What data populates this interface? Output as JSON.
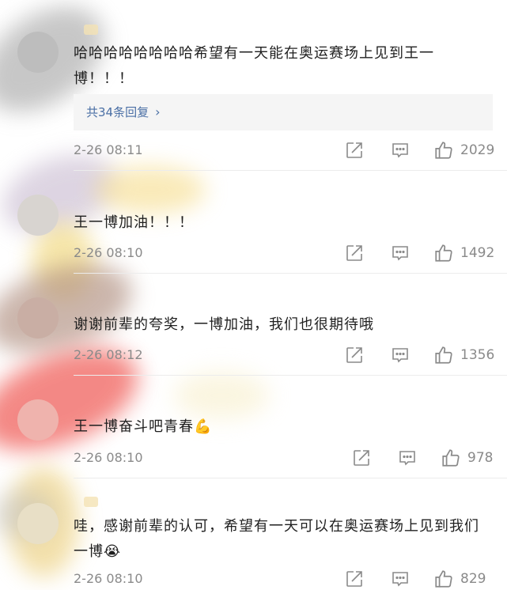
{
  "comments": [
    {
      "text": "哈哈哈哈哈哈哈哈希望有一天能在奥运赛场上见到王一博！！！",
      "reply_label": "共34条回复",
      "time": "2-26 08:11",
      "likes": "2029"
    },
    {
      "text": "王一博加油！！！",
      "time": "2-26 08:10",
      "likes": "1492"
    },
    {
      "text": "谢谢前辈的夸奖，一博加油，我们也很期待哦",
      "time": "2-26 08:12",
      "likes": "1356"
    },
    {
      "text": "王一博奋斗吧青春💪",
      "time": "2-26 08:10",
      "likes": "978"
    },
    {
      "text": "哇，感谢前辈的认可，希望有一天可以在奥运赛场上见到我们一博😭",
      "time": "2-26 08:10",
      "likes": "829"
    }
  ],
  "icons": {
    "share": "share-icon",
    "comment": "comment-icon",
    "like": "thumbs-up-icon",
    "chevron": "chevron-right-icon"
  },
  "colors": {
    "reply_link": "#4a6fa5",
    "meta_gray": "#8a8a8a",
    "divider": "#ececec"
  }
}
